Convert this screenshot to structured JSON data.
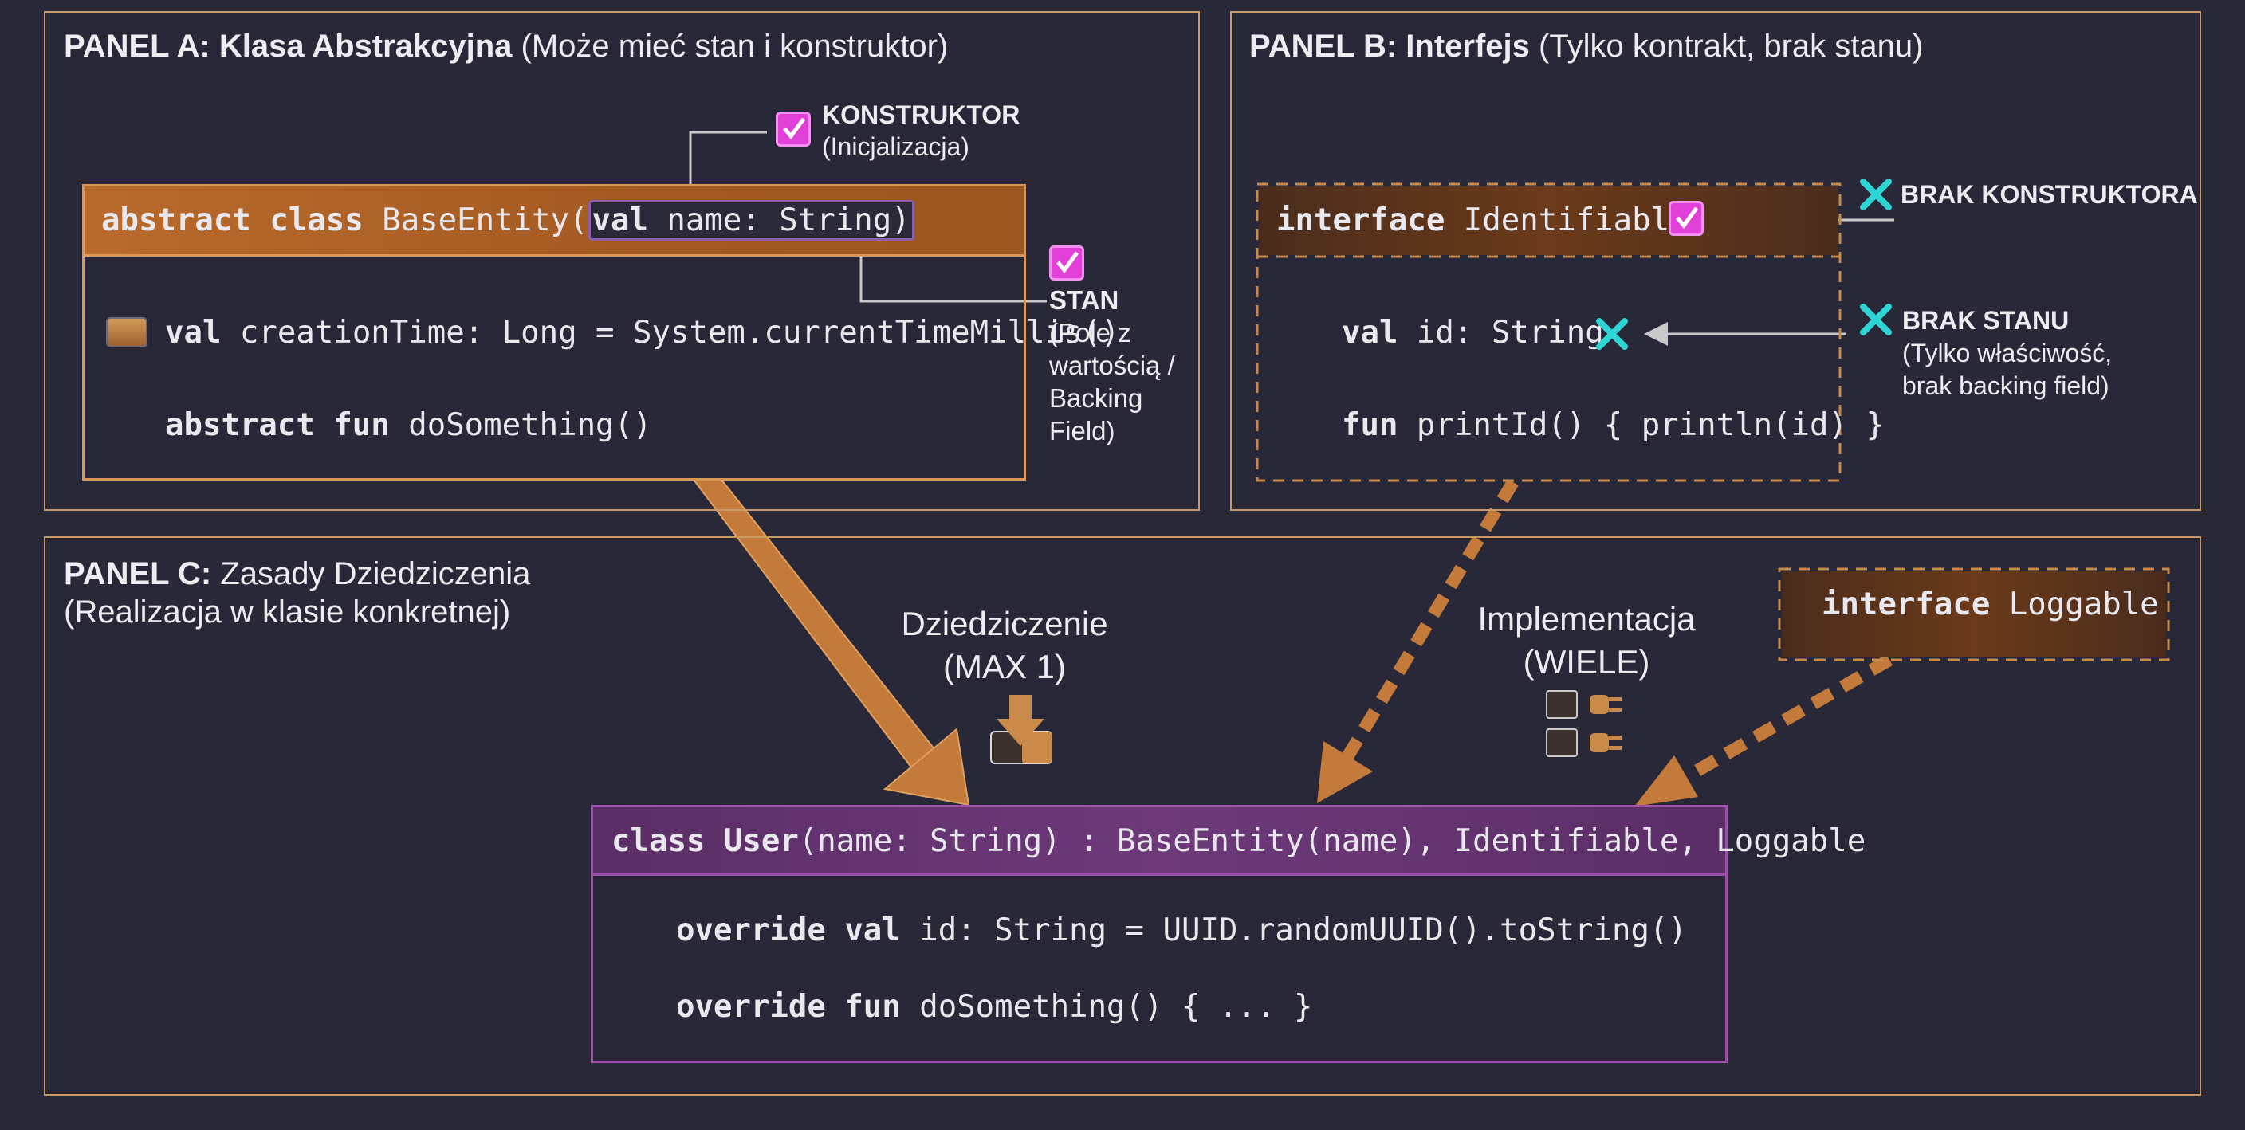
{
  "panels": {
    "a": {
      "title_bold": "PANEL A: Klasa Abstrakcyjna",
      "title_rest": " (Może mieć stan i konstruktor)"
    },
    "b": {
      "title_bold": "PANEL B: Interfejs",
      "title_rest": " (Tylko kontrakt, brak stanu)"
    },
    "c": {
      "title_bold": "PANEL C:",
      "title_rest": " Zasady Dziedziczenia",
      "title_line2": "(Realizacja w klasie konkretnej)"
    }
  },
  "base_entity": {
    "kw": "abstract class",
    "name": " BaseEntity(",
    "param_kw": "val",
    "param_rest": " name: String",
    "close": ")",
    "line1_kw": "val",
    "line1_rest": " creationTime: Long = System.currentTimeMillis()",
    "line2_kw": "abstract fun",
    "line2_rest": " doSomething()"
  },
  "annotations_a": {
    "konstruktor_title": "KONSTRUKTOR",
    "konstruktor_sub": "(Inicjalizacja)",
    "stan_title": "STAN",
    "stan_l1": "(Pole z",
    "stan_l2": "wartością /",
    "stan_l3": "Backing",
    "stan_l4": "Field)"
  },
  "identifiable": {
    "kw": "interface",
    "name": " Identifiable",
    "line1_kw": "val",
    "line1_rest": " id: String",
    "line2_kw": "fun",
    "line2_rest": " printId() { println(id) }"
  },
  "annotations_b": {
    "brak_konstruktora": "BRAK KONSTRUKTORA",
    "brak_stanu": "BRAK STANU",
    "brak_stanu_l1": "(Tylko właściwość,",
    "brak_stanu_l2": "brak backing field)"
  },
  "loggable": {
    "kw": "interface",
    "name": " Loggable"
  },
  "labels": {
    "inheritance_l1": "Dziedziczenie",
    "inheritance_l2": "(MAX 1)",
    "implementation_l1": "Implementacja",
    "implementation_l2": "(WIELE)"
  },
  "user": {
    "kw": "class User",
    "rest": "(name: String) : BaseEntity(name), Identifiable, Loggable",
    "line1_kw": "override val",
    "line1_rest": " id: String = UUID.randomUUID().toString()",
    "line2_kw": "override fun",
    "line2_rest": " doSomething() { ... }"
  },
  "colors": {
    "background": "#282838",
    "orange": "#c98a4a",
    "orange_dark": "#8a4e1f",
    "purple": "#9b4fa8",
    "magenta_check": "#e23fd8",
    "cyan_cross": "#2fd4d4"
  }
}
